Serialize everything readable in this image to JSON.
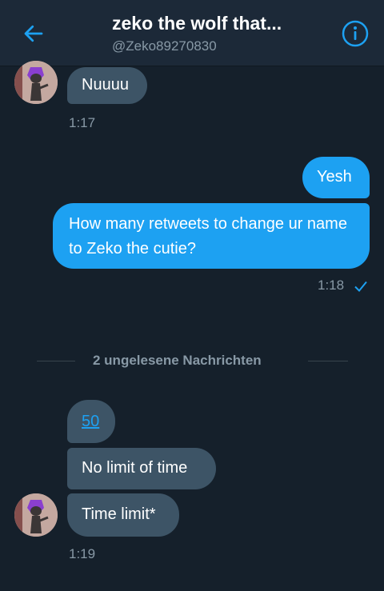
{
  "header": {
    "title": "zeko the wolf that...",
    "handle": "@Zeko89270830"
  },
  "messages": [
    {
      "direction": "received",
      "text": "Nuuuu"
    },
    {
      "direction": "sent",
      "text": "Yesh"
    },
    {
      "direction": "sent",
      "text": "How many retweets to change ur name to Zeko the cutie?"
    },
    {
      "direction": "received",
      "text": "50",
      "is_link": true
    },
    {
      "direction": "received",
      "text": "No limit of time"
    },
    {
      "direction": "received",
      "text": "Time limit*"
    }
  ],
  "timestamps": {
    "first_received": "1:17",
    "sent": "1:18",
    "last_received": "1:19"
  },
  "divider": {
    "text": "2 ungelesene Nachrichten"
  },
  "colors": {
    "background": "#15202b",
    "header": "#1c2938",
    "accent": "#1da1f2",
    "received_bubble": "#3d5466",
    "muted_text": "#8899a6"
  },
  "icons": {
    "back": "arrow-left-icon",
    "info": "info-circle-icon",
    "read_receipt": "checkmark-icon"
  }
}
